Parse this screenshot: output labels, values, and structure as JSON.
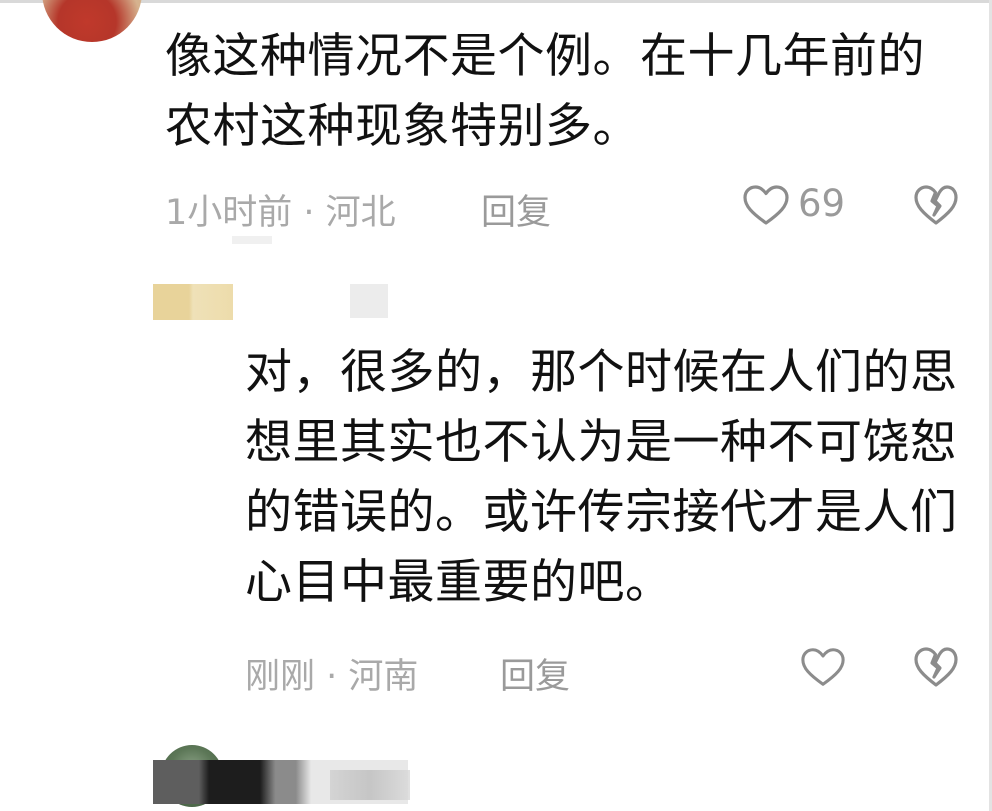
{
  "comment": {
    "lines": [
      "像这种情况不是个例。在十几年前的",
      "农村这种现象特别多。"
    ],
    "meta": "1小时前 · 河北",
    "reply_label": "回复",
    "like_count": "69"
  },
  "reply": {
    "lines": [
      "对，很多的，那个时候在人们的思",
      "想里其实也不认为是一种不可饶恕",
      "的错误的。或许传宗接代才是人们",
      "心目中最重要的吧。"
    ],
    "meta": "刚刚 · 河南",
    "reply_label": "回复"
  },
  "icons": {
    "like": "heart-outline-icon",
    "dislike": "broken-heart-icon"
  },
  "colors": {
    "text": "#111111",
    "meta": "#a9a9a9",
    "icon": "#8c8c8c"
  }
}
